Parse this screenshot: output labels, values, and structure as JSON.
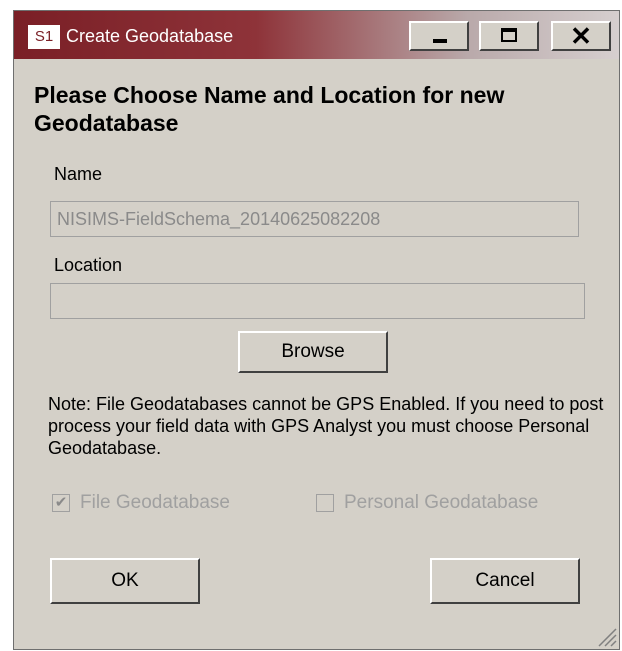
{
  "window": {
    "app_icon_text": "S1",
    "title": "Create Geodatabase",
    "minimize_glyph": "",
    "close_glyph": "✕"
  },
  "heading": "Please Choose Name and Location for new Geodatabase",
  "name_field": {
    "label": "Name",
    "value": "NISIMS-FieldSchema_20140625082208"
  },
  "location_field": {
    "label": "Location",
    "value": ""
  },
  "browse_label": "Browse",
  "note": "Note: File Geodatabases cannot be GPS Enabled.  If you need to post process your field data with GPS Analyst you must choose Personal Geodatabase.",
  "options": {
    "file_gdb": {
      "label": "File Geodatabase",
      "checked": true,
      "mark": "✔"
    },
    "personal_gdb": {
      "label": "Personal Geodatabase",
      "checked": false,
      "mark": ""
    }
  },
  "ok_label": "OK",
  "cancel_label": "Cancel",
  "colors": {
    "titlebar_start": "#7a1f26",
    "dialog_face": "#d4d0c8",
    "disabled_text": "#a0a0a0"
  }
}
